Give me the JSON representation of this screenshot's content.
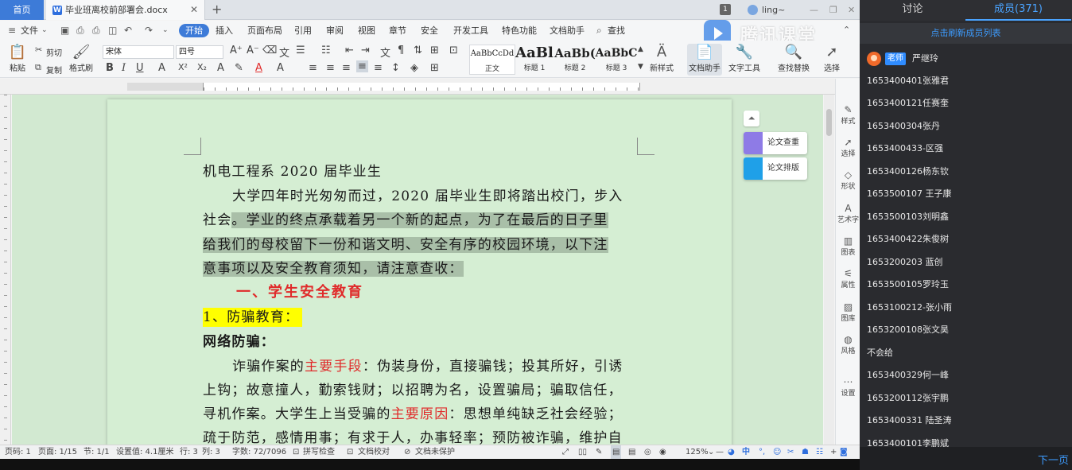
{
  "tabs": {
    "home": "首页",
    "doc": "毕业班离校前部署会.docx",
    "badge_num": "1",
    "user": "ling~"
  },
  "menu": {
    "file": "文件",
    "items": [
      "开始",
      "插入",
      "页面布局",
      "引用",
      "审阅",
      "视图",
      "章节",
      "安全",
      "开发工具",
      "特色功能",
      "文档助手"
    ],
    "search": "查找"
  },
  "watermark": {
    "text": "腾讯课堂"
  },
  "toolbar": {
    "paste": "粘贴",
    "cut": "剪切",
    "copy": "复制",
    "format_painter": "格式刷",
    "font_name": "宋体",
    "font_size": "四号",
    "styles": [
      {
        "preview": "AaBbCcDd",
        "label": "正文"
      },
      {
        "preview": "AaBl",
        "label": "标题 1"
      },
      {
        "preview": "AaBb(",
        "label": "标题 2"
      },
      {
        "preview": "AaBbC",
        "label": "标题 3"
      }
    ],
    "new_style": "新样式",
    "doc_assistant": "文档助手",
    "text_tools": "文字工具",
    "find_replace": "查找替换",
    "select": "选择"
  },
  "document": {
    "line1": "机电工程系 2020 届毕业生",
    "line2": "大学四年时光匆匆而过，2020 届毕业生即将踏出校门，步入",
    "line3a": "社会",
    "line3b": "。学业的终点承载着另一个新的起点，为了在最后的日子里",
    "line4": "给我们的母校留下一份和谐文明、安全有序的校园环境，以下注",
    "line5": "意事项以及安全教育须知，请注意查收：",
    "heading1": "一、学生安全教育",
    "subheading1": "1、防骗教育：",
    "subheading2": "网络防骗：",
    "p1a": "诈骗作案的",
    "p1b": "主要手段",
    "p1c": "：伪装身份，直接骗钱；投其所好，引诱",
    "p2": "上钩；故意撞人，勤索钱财；以招聘为名，设置骗局；骗取信任，",
    "p3a": "寻机作案。大学生上当受骗的",
    "p3b": "主要原因",
    "p3c": "：思想单纯缺乏社会经验；",
    "p4": "疏于防范，感情用事；有求于人，办事轻率；预防被诈骗，维护自"
  },
  "float_buttons": {
    "check": "论文查重",
    "layout": "论文排版"
  },
  "taskpane": [
    "样式",
    "选择",
    "形状",
    "艺术字",
    "图表",
    "属性",
    "图库",
    "风格",
    "设置"
  ],
  "statusbar": {
    "page_code": "页码: 1",
    "pages": "页面: 1/15",
    "section": "节: 1/1",
    "setting": "设置值: 4.1厘米",
    "row": "行: 3",
    "col": "列: 3",
    "words": "字数: 72/7096",
    "spell": "拼写检查",
    "proof": "文档校对",
    "protect": "文档未保护",
    "zoom": "125%",
    "ime": "中"
  },
  "panel": {
    "tab_discuss": "讨论",
    "tab_members": "成员(371)",
    "refresh": "点击刷新成员列表",
    "teacher_badge": "老师",
    "teacher_name": "严继玲",
    "members": [
      "1653400401张雅君",
      "1653400121任赛奎",
      "1653400304张丹",
      "1653400433-区强",
      "1653400126杨东钦",
      "1653500107 王子康",
      "1653500103刘明鑫",
      "1653400422朱俊树",
      "1653200203 蓝创",
      "1653500105罗玲玉",
      "1653100212-张小雨",
      "1653200108张文昊",
      "不会给",
      "1653400329何一峰",
      "1653200112张宇鹏",
      "1653400331 陆圣涛",
      "1653400101李鹏斌"
    ],
    "next_page": "下一页"
  }
}
